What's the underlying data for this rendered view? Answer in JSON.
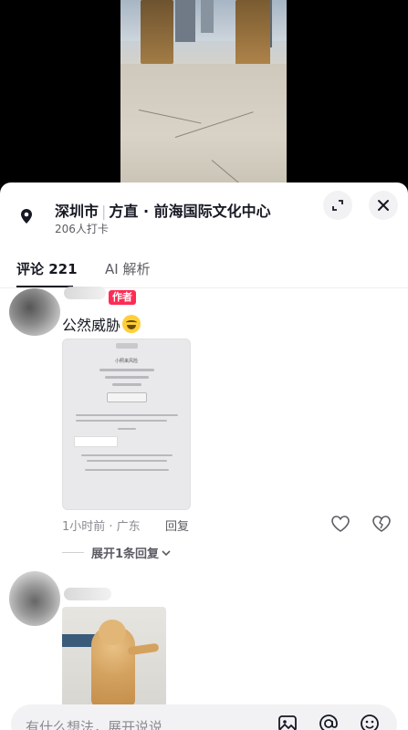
{
  "location": {
    "city": "深圳市",
    "place": "方直 · 前海国际文化中心",
    "checkins": "206人打卡"
  },
  "tabs": [
    {
      "label": "评论 221",
      "active": true
    },
    {
      "label": "AI 解析",
      "active": false
    }
  ],
  "comments": [
    {
      "badge": "作者",
      "text": "公然威胁",
      "emoji": "grimacing-face",
      "screenshot": {
        "title": "小照来风险"
      },
      "time_location": "1小时前 · 广东",
      "reply_label": "回复",
      "expand_label": "展开1条回复"
    },
    {
      "image": "dog-gif"
    }
  ],
  "input": {
    "placeholder": "有什么想法，展开说说"
  },
  "icons": {
    "location": "location-pin-icon",
    "expand": "expand-icon",
    "close": "close-icon",
    "like": "heart-icon",
    "dislike": "broken-heart-icon",
    "image": "image-icon",
    "mention": "at-icon",
    "emoji": "emoji-icon"
  },
  "colors": {
    "accent": "#fe2c55",
    "text": "#161823",
    "muted": "#8a8b91"
  }
}
